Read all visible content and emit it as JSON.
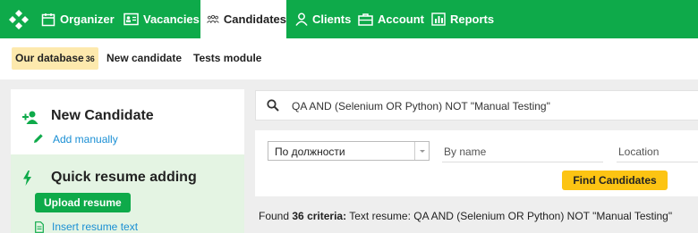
{
  "nav": {
    "items": [
      {
        "label": "Organizer",
        "icon": "calendar-icon"
      },
      {
        "label": "Vacancies",
        "icon": "id-card-icon"
      },
      {
        "label": "Candidates",
        "icon": "people-icon",
        "active": true
      },
      {
        "label": "Clients",
        "icon": "person-icon"
      },
      {
        "label": "Account",
        "icon": "briefcase-icon"
      },
      {
        "label": "Reports",
        "icon": "bar-chart-icon"
      }
    ],
    "brand_color": "#0eaa4a"
  },
  "subnav": {
    "our_database": "Our database",
    "our_database_count": "36",
    "new_candidate": "New candidate",
    "tests_module": "Tests module"
  },
  "left_panel": {
    "new_candidate_title": "New Candidate",
    "add_manually": "Add manually",
    "quick_title": "Quick resume adding",
    "upload_resume": "Upload resume",
    "insert_resume_text": "Insert resume text"
  },
  "search": {
    "query": "QA AND (Selenium OR Python) NOT \"Manual Testing\""
  },
  "filters": {
    "select_value": "По должности",
    "name_placeholder": "By name",
    "location_placeholder": "Location",
    "find_button": "Find Candidates"
  },
  "results": {
    "found_label": "Found",
    "count": "36",
    "criteria_label": "criteria:",
    "criteria_text": "Text resume: QA AND (Selenium OR Python) NOT \"Manual Testing\""
  },
  "colors": {
    "accent_green": "#0eaa4a",
    "link_blue": "#1a8fd4",
    "button_yellow": "#fcc413",
    "active_tab_bg": "#fde9ad"
  }
}
